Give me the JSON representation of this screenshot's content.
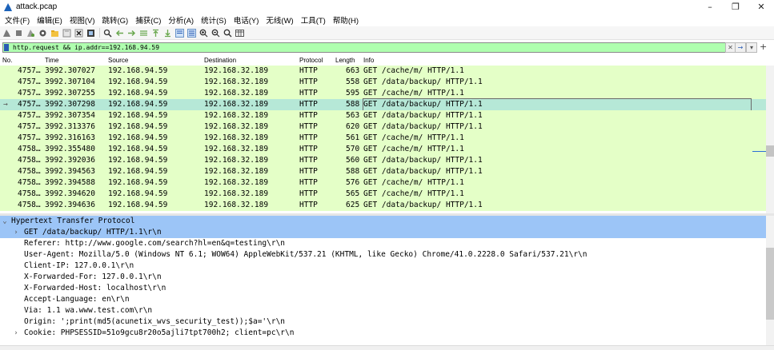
{
  "window": {
    "title": "attack.pcap",
    "controls": {
      "minimize": "–",
      "maximize": "❐",
      "close": "✕"
    }
  },
  "menu": [
    "文件(F)",
    "编辑(E)",
    "视图(V)",
    "跳转(G)",
    "捕获(C)",
    "分析(A)",
    "统计(S)",
    "电话(Y)",
    "无线(W)",
    "工具(T)",
    "帮助(H)"
  ],
  "filter": {
    "value": "http.request && ip.addr==192.168.94.59",
    "clear": "✕",
    "apply": "→",
    "dropdown": "▾",
    "add": "+"
  },
  "columns": [
    "No.",
    "Time",
    "Source",
    "Destination",
    "Protocol",
    "Length",
    "Info"
  ],
  "packets": [
    {
      "no": "4757…",
      "time": "3992.307027",
      "src": "192.168.94.59",
      "dst": "192.168.32.189",
      "proto": "HTTP",
      "len": "663",
      "info": "GET /cache/m/ HTTP/1.1"
    },
    {
      "no": "4757…",
      "time": "3992.307104",
      "src": "192.168.94.59",
      "dst": "192.168.32.189",
      "proto": "HTTP",
      "len": "558",
      "info": "GET /data/backup/ HTTP/1.1"
    },
    {
      "no": "4757…",
      "time": "3992.307255",
      "src": "192.168.94.59",
      "dst": "192.168.32.189",
      "proto": "HTTP",
      "len": "595",
      "info": "GET /cache/m/ HTTP/1.1"
    },
    {
      "no": "4757…",
      "time": "3992.307298",
      "src": "192.168.94.59",
      "dst": "192.168.32.189",
      "proto": "HTTP",
      "len": "588",
      "info": "GET /data/backup/ HTTP/1.1",
      "selected": true
    },
    {
      "no": "4757…",
      "time": "3992.307354",
      "src": "192.168.94.59",
      "dst": "192.168.32.189",
      "proto": "HTTP",
      "len": "563",
      "info": "GET /data/backup/ HTTP/1.1"
    },
    {
      "no": "4757…",
      "time": "3992.313376",
      "src": "192.168.94.59",
      "dst": "192.168.32.189",
      "proto": "HTTP",
      "len": "620",
      "info": "GET /data/backup/ HTTP/1.1"
    },
    {
      "no": "4757…",
      "time": "3992.316163",
      "src": "192.168.94.59",
      "dst": "192.168.32.189",
      "proto": "HTTP",
      "len": "561",
      "info": "GET /cache/m/ HTTP/1.1"
    },
    {
      "no": "4758…",
      "time": "3992.355480",
      "src": "192.168.94.59",
      "dst": "192.168.32.189",
      "proto": "HTTP",
      "len": "570",
      "info": "GET /cache/m/ HTTP/1.1"
    },
    {
      "no": "4758…",
      "time": "3992.392036",
      "src": "192.168.94.59",
      "dst": "192.168.32.189",
      "proto": "HTTP",
      "len": "560",
      "info": "GET /data/backup/ HTTP/1.1"
    },
    {
      "no": "4758…",
      "time": "3992.394563",
      "src": "192.168.94.59",
      "dst": "192.168.32.189",
      "proto": "HTTP",
      "len": "588",
      "info": "GET /data/backup/ HTTP/1.1"
    },
    {
      "no": "4758…",
      "time": "3992.394588",
      "src": "192.168.94.59",
      "dst": "192.168.32.189",
      "proto": "HTTP",
      "len": "576",
      "info": "GET /cache/m/ HTTP/1.1"
    },
    {
      "no": "4758…",
      "time": "3992.394620",
      "src": "192.168.94.59",
      "dst": "192.168.32.189",
      "proto": "HTTP",
      "len": "565",
      "info": "GET /cache/m/ HTTP/1.1"
    },
    {
      "no": "4758…",
      "time": "3992.394636",
      "src": "192.168.94.59",
      "dst": "192.168.32.189",
      "proto": "HTTP",
      "len": "625",
      "info": "GET /data/backup/ HTTP/1.1"
    }
  ],
  "details": [
    {
      "text": "Hypertext Transfer Protocol",
      "expander": "⌄",
      "level": 0,
      "highlight": true
    },
    {
      "text": "GET /data/backup/ HTTP/1.1\\r\\n",
      "expander": "›",
      "level": 1,
      "highlight": true
    },
    {
      "text": "Referer: http://www.google.com/search?hl=en&q=testing\\r\\n",
      "expander": "",
      "level": 1
    },
    {
      "text": "User-Agent: Mozilla/5.0 (Windows NT 6.1; WOW64) AppleWebKit/537.21 (KHTML, like Gecko) Chrome/41.0.2228.0 Safari/537.21\\r\\n",
      "expander": "",
      "level": 1
    },
    {
      "text": "Client-IP: 127.0.0.1\\r\\n",
      "expander": "",
      "level": 1
    },
    {
      "text": "X-Forwarded-For: 127.0.0.1\\r\\n",
      "expander": "",
      "level": 1
    },
    {
      "text": "X-Forwarded-Host: localhost\\r\\n",
      "expander": "",
      "level": 1
    },
    {
      "text": "Accept-Language: en\\r\\n",
      "expander": "",
      "level": 1
    },
    {
      "text": "Via: 1.1 wa.www.test.com\\r\\n",
      "expander": "",
      "level": 1
    },
    {
      "text": "Origin: ';print(md5(acunetix_wvs_security_test));$a='\\r\\n",
      "expander": "",
      "level": 1
    },
    {
      "text": "Cookie: PHPSESSID=51o9gcu8r20o5ajli7tpt700h2; client=pc\\r\\n",
      "expander": "›",
      "level": 1
    }
  ],
  "colors": {
    "row_bg": "#e4ffc7",
    "row_selected": "#b6e8d7",
    "filter_bg": "#afffaf",
    "detail_highlight": "#9cc5f7"
  }
}
